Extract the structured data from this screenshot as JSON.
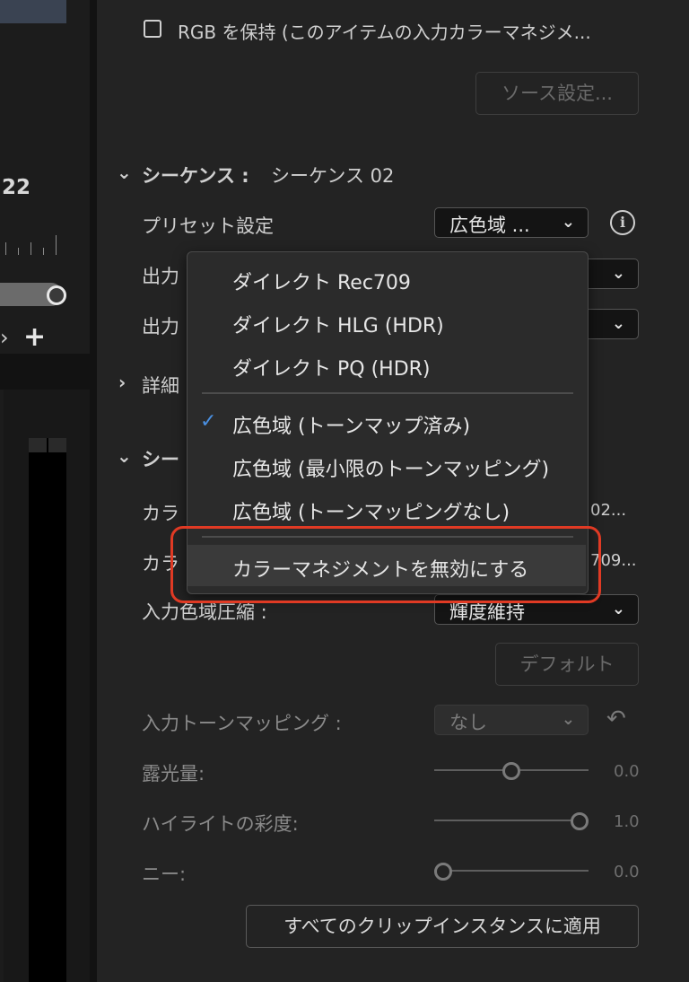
{
  "left": {
    "timecode": "22",
    "nav_chevron": "›",
    "add_label": "+"
  },
  "source": {
    "preserve_rgb_label": "RGB を保持 (このアイテムの入力カラーマネジメ...",
    "source_settings_button": "ソース設定..."
  },
  "sequence": {
    "section_title": "シーケンス :",
    "section_name": "シーケンス 02",
    "preset_label": "プリセット設定",
    "preset_value": "広色域 ...",
    "output1_label": "出力",
    "output2_label": "出力",
    "details_label": "詳細"
  },
  "second_section": {
    "title_partial": "シー",
    "row1_label": "カラ",
    "row1_value_tail": "02...",
    "row2_label": "カラ",
    "row2_value_tail": "709...",
    "gamut_label": "入力色域圧縮 :",
    "gamut_value": "輝度維持",
    "default_button": "デフォルト",
    "tonemap_label": "入力トーンマッピング :",
    "tonemap_value": "なし",
    "exposure_label": "露光量:",
    "exposure_value": "0.0",
    "exposure_level": 0.5,
    "highlight_sat_label": "ハイライトの彩度:",
    "highlight_sat_value": "1.0",
    "highlight_sat_level": 1.0,
    "knee_label": "ニー:",
    "knee_value": "0.0",
    "knee_level": 0.0,
    "apply_all_button": "すべてのクリップインスタンスに適用"
  },
  "menu": {
    "items": [
      "ダイレクト Rec709",
      "ダイレクト HLG (HDR)",
      "ダイレクト PQ (HDR)",
      "広色域 (トーンマップ済み)",
      "広色域 (最小限のトーンマッピング)",
      "広色域 (トーンマッピングなし)",
      "カラーマネジメントを無効にする"
    ],
    "selected_index": 3,
    "highlighted_index": 6,
    "check_glyph": "✓"
  },
  "colors": {
    "accent_check": "#4a90e2",
    "annotation_ring": "#e03a24"
  }
}
